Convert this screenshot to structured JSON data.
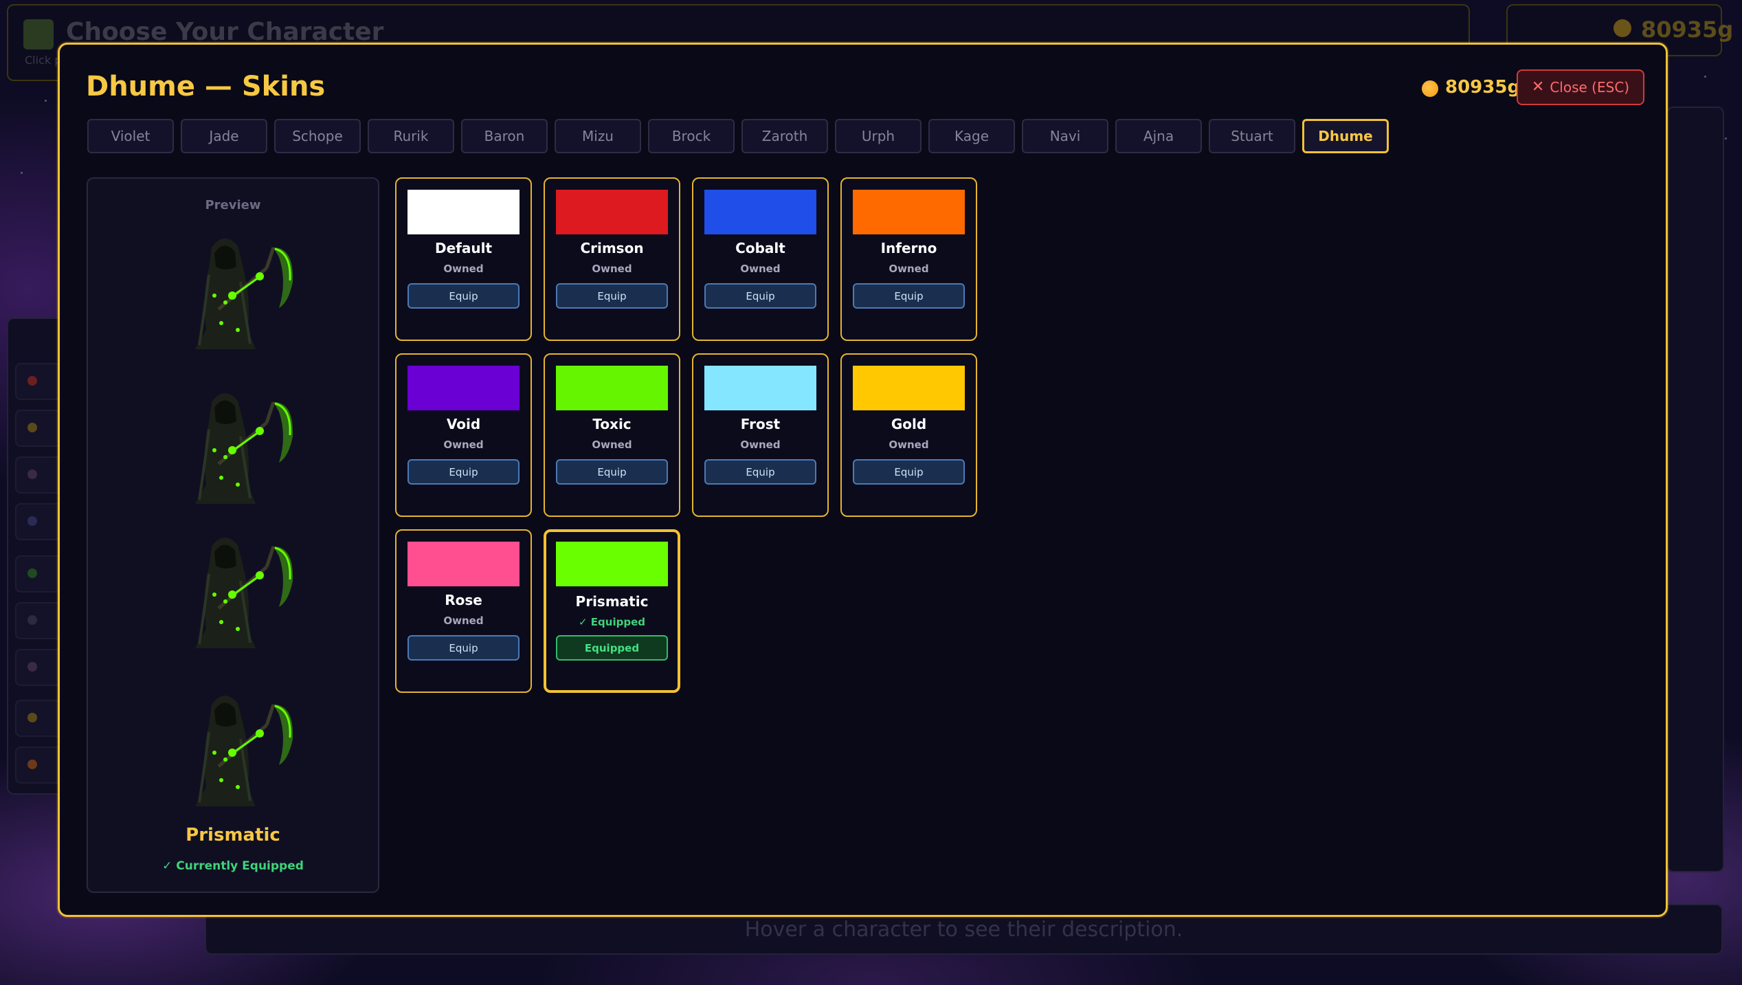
{
  "background": {
    "title": "Choose Your Character",
    "subtitle": "Click p",
    "gold": "80935g",
    "description": "Hover a character to see their description."
  },
  "modal": {
    "title": "Dhume — Skins",
    "gold": "80935g",
    "close_label": "Close (ESC)",
    "close_icon": "✕"
  },
  "tabs": [
    "Violet",
    "Jade",
    "Schope",
    "Rurik",
    "Baron",
    "Mizu",
    "Brock",
    "Zaroth",
    "Urph",
    "Kage",
    "Navi",
    "Ajna",
    "Stuart",
    "Dhume"
  ],
  "active_tab": "Dhume",
  "preview": {
    "label": "Preview",
    "skin_name": "Prismatic",
    "status": "✓ Currently Equipped",
    "glow_color": "#66ff00"
  },
  "skins": [
    {
      "name": "Default",
      "status": "Owned",
      "button": "Equip",
      "color": "#ffffff"
    },
    {
      "name": "Crimson",
      "status": "Owned",
      "button": "Equip",
      "color": "#dc1a1f"
    },
    {
      "name": "Cobalt",
      "status": "Owned",
      "button": "Equip",
      "color": "#1f4ee8"
    },
    {
      "name": "Inferno",
      "status": "Owned",
      "button": "Equip",
      "color": "#ff6a00"
    },
    {
      "name": "Void",
      "status": "Owned",
      "button": "Equip",
      "color": "#6a00d4"
    },
    {
      "name": "Toxic",
      "status": "Owned",
      "button": "Equip",
      "color": "#66f500"
    },
    {
      "name": "Frost",
      "status": "Owned",
      "button": "Equip",
      "color": "#84e6ff"
    },
    {
      "name": "Gold",
      "status": "Owned",
      "button": "Equip",
      "color": "#ffc800"
    },
    {
      "name": "Rose",
      "status": "Owned",
      "button": "Equip",
      "color": "#ff4f91"
    },
    {
      "name": "Prismatic",
      "status": "✓ Equipped",
      "button": "Equipped",
      "color": "#6aff00",
      "equipped": true
    }
  ]
}
